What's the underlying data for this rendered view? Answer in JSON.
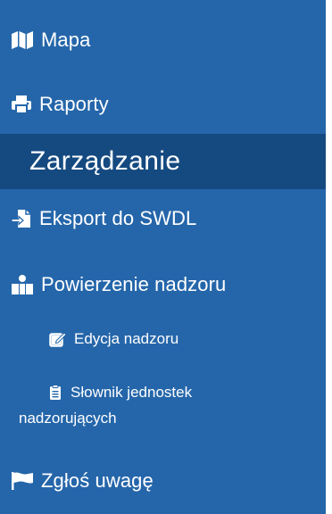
{
  "nav": {
    "items": [
      {
        "label": "Mapa",
        "icon": "map-icon"
      },
      {
        "label": "Raporty",
        "icon": "printer-icon"
      }
    ],
    "section_title": "Zarządzanie",
    "management": [
      {
        "label": "Eksport do SWDL",
        "icon": "file-export-icon"
      },
      {
        "label": "Powierzenie nadzoru",
        "icon": "user-group-icon"
      }
    ],
    "subitems": [
      {
        "label": "Edycja nadzoru",
        "icon": "edit-icon"
      },
      {
        "label_line1": "Słownik jednostek",
        "label_line2": "nadzorujących",
        "icon": "clipboard-icon"
      }
    ],
    "report": {
      "label": "Zgłoś uwagę",
      "icon": "flag-icon"
    }
  },
  "colors": {
    "sidebar_bg": "#2566aa",
    "section_bg": "#144a80",
    "text": "#ffffff"
  }
}
